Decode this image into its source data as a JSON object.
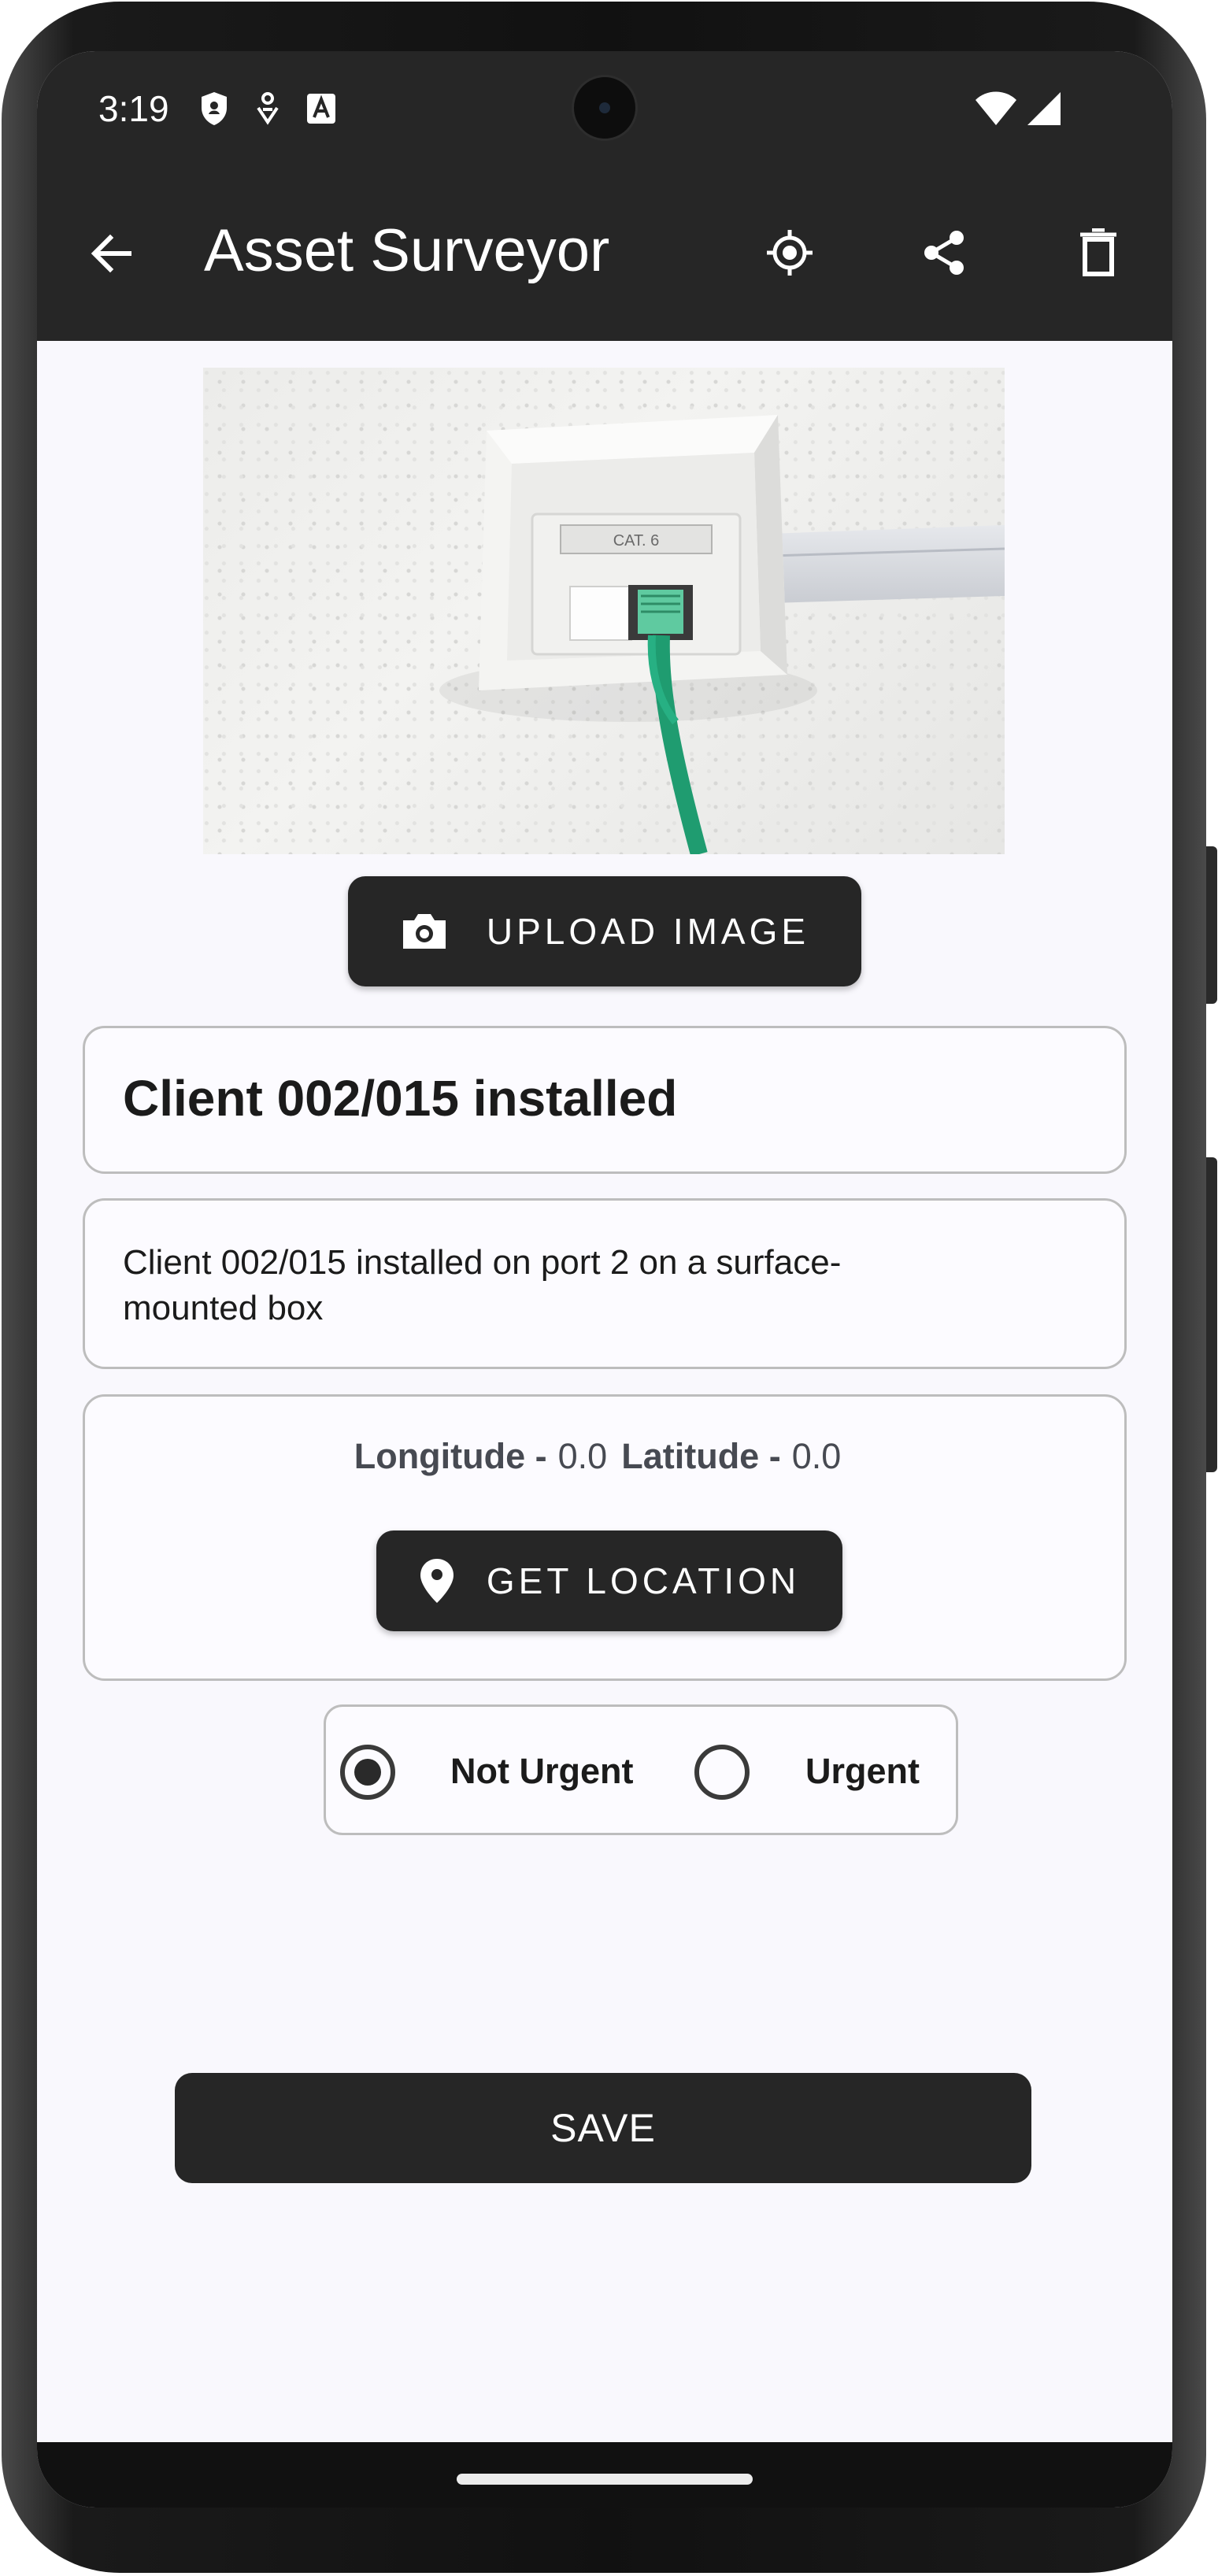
{
  "status_bar": {
    "time": "3:19",
    "icons": [
      "shield-icon",
      "notification-icon",
      "font-icon",
      "wifi-icon",
      "signal-icon"
    ]
  },
  "app_bar": {
    "title": "Asset Surveyor",
    "actions": [
      "back-arrow-icon",
      "gps-target-icon",
      "share-icon",
      "delete-icon"
    ]
  },
  "photo": {
    "label": "CAT. 6"
  },
  "upload_button": {
    "label": "UPLOAD IMAGE",
    "icon": "camera-icon"
  },
  "title_field": {
    "value": "Client 002/015 installed"
  },
  "description_field": {
    "value": "Client 002/015 installed on port 2 on a surface-mounted box"
  },
  "location": {
    "longitude_label": "Longitude -",
    "longitude_value": "0.0",
    "latitude_label": "Latitude -",
    "latitude_value": "0.0",
    "button_label": "GET LOCATION",
    "button_icon": "location-pin-icon"
  },
  "urgency": {
    "options": [
      {
        "label": "Not Urgent",
        "selected": true
      },
      {
        "label": "Urgent",
        "selected": false
      }
    ]
  },
  "save_button": {
    "label": "SAVE"
  },
  "colors": {
    "bar": "#262626",
    "background": "#f9f8fd",
    "border": "#bdbdbd",
    "cable": "#22a37a"
  }
}
